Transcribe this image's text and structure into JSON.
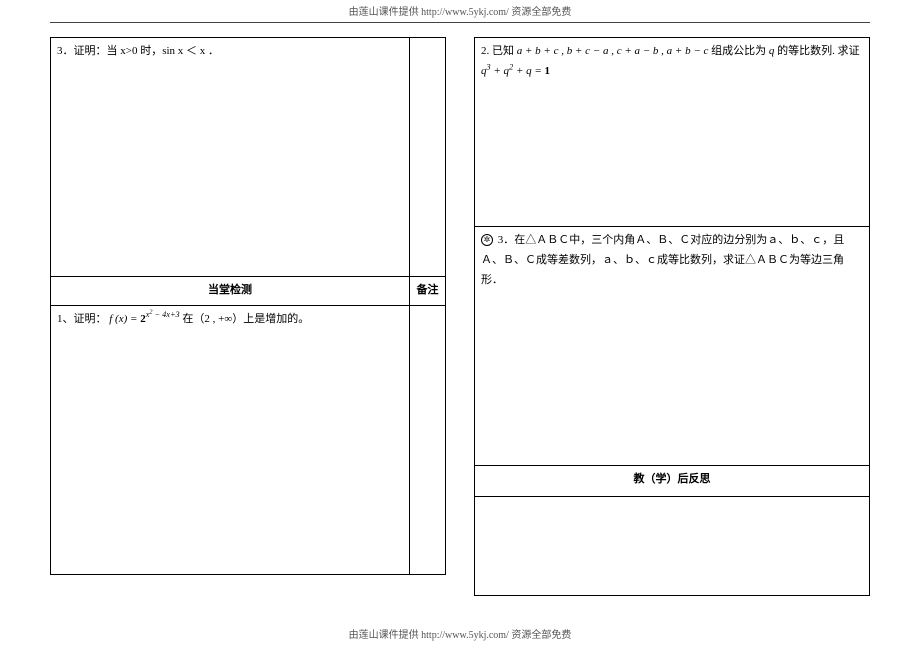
{
  "header": {
    "line": "由莲山课件提供 http://www.5ykj.com/    资源全部免费"
  },
  "footer": {
    "line": "由莲山课件提供 http://www.5ykj.com/    资源全部免费"
  },
  "left": {
    "problem3_prefix": "3．证明：当 x>0 时，sin x ＜ x ．",
    "section_label": "当堂检测",
    "note_label": "备注",
    "problem1_prefix": "1、证明：",
    "problem1_math": "f (x) = 2^{\\,x^2 − 4x + 3}",
    "problem1_suffix": "在（2 , +∞）上是增加的。"
  },
  "right": {
    "problem2_line1": "2. 已知 a+b+c , b+c−a , c+a−b , a+b−c 组成公比为 q 的等比数列. 求证",
    "problem2_line2": "q^3 + q^2 + q = 1",
    "problem3_line": "3．在△ＡＢＣ中，三个内角Ａ、Ｂ、Ｃ对应的边分别为ａ、ｂ、ｃ，且Ａ、Ｂ、Ｃ成等差数列，ａ、ｂ、ｃ成等比数列，求证△ＡＢＣ为等边三角形．",
    "reflection_label": "教（学）后反思"
  }
}
